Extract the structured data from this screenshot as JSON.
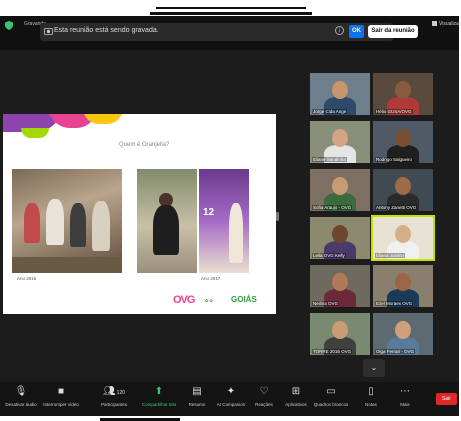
{
  "meeting": {
    "title": "Gravando",
    "recording_notice": "Esta reunião está sendo gravada.",
    "ok_label": "OK",
    "leave_label": "Sair da reunião",
    "view_label": "Visualizar"
  },
  "slide": {
    "title": "Quem é Oranjella?",
    "caption_left": "Ano 2016",
    "caption_right": "Ano 2017",
    "logo_ovg": "OVG",
    "logo_goias": "GOIÁS"
  },
  "participants": [
    {
      "name": "Jorge Cida Ange"
    },
    {
      "name": "Hélio GUSA/OVG"
    },
    {
      "name": "Eliane Sandinha"
    },
    {
      "name": "Rodrigo Salgueiro"
    },
    {
      "name": "Sofia Araujo - OVG"
    },
    {
      "name": "Antony Zanetti OVG"
    },
    {
      "name": "Leila OVG Kelly"
    },
    {
      "name": "Eliana Justino"
    },
    {
      "name": "Neilina OVG"
    },
    {
      "name": "Ezel Moraes OVG"
    },
    {
      "name": "TORRE 2016 OVG"
    },
    {
      "name": "Olga Ferrari - OVG"
    }
  ],
  "toolbar": {
    "items": [
      {
        "label": "Desativar áudio",
        "icon": "mic-icon"
      },
      {
        "label": "Interromper vídeo",
        "icon": "video-icon"
      },
      {
        "label": "Participantes",
        "icon": "participants-icon",
        "count": "120"
      },
      {
        "label": "Compartilhar tela",
        "icon": "share-screen-icon"
      },
      {
        "label": "Resumo",
        "icon": "summary-icon"
      },
      {
        "label": "AI Companion",
        "icon": "ai-companion-icon"
      },
      {
        "label": "Reações",
        "icon": "reactions-icon"
      },
      {
        "label": "Aplicativos",
        "icon": "apps-icon"
      },
      {
        "label": "Quadros brancos",
        "icon": "whiteboard-icon"
      },
      {
        "label": "Notas",
        "icon": "notes-icon"
      },
      {
        "label": "Mais",
        "icon": "more-icon"
      }
    ],
    "end_label": "Sair"
  },
  "colors": {
    "accent": "#0e72ed",
    "share_green": "#3cc46c",
    "end_red": "#e02828",
    "active_speaker": "#c7e000"
  }
}
